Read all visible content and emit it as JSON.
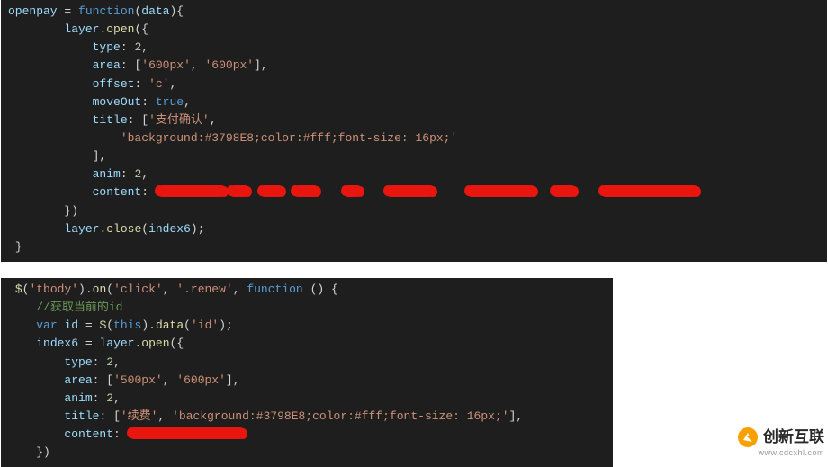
{
  "code1": {
    "fn_name": "openpay",
    "param": "data",
    "open_call": "layer.open",
    "close_call": "layer.close",
    "close_arg": "index6",
    "type_key": "type",
    "type_val": "2",
    "area_key": "area",
    "area_v1": "'600px'",
    "area_v2": "'600px'",
    "offset_key": "offset",
    "offset_val": "'c'",
    "moveOut_key": "moveOut",
    "moveOut_val": "true",
    "title_key": "title",
    "title_line1": "'支付确认'",
    "title_line2": "'background:#3798E8;color:#fff;font-size: 16px;'",
    "anim_key": "anim",
    "anim_val": "2",
    "content_key": "content"
  },
  "code2": {
    "selector_call": "$('tbody').on",
    "on_event": "'click'",
    "on_sel": "'.renew'",
    "on_fn": "function",
    "comment": "//获取当前的id",
    "id_decl": "var id = $(this).data('id');",
    "index6": "index6",
    "open_call": "layer.open",
    "type_key": "type",
    "type_val": "2",
    "area_key": "area",
    "area_v1": "'500px'",
    "area_v2": "'600px'",
    "anim_key": "anim",
    "anim_val": "2",
    "title_key": "title",
    "title_v1": "'续费'",
    "title_v2": "'background:#3798E8;color:#fff;font-size: 16px;'",
    "content_key": "content"
  },
  "watermark": {
    "text": "创新互联",
    "sub": "www.cdcxhl.com"
  }
}
